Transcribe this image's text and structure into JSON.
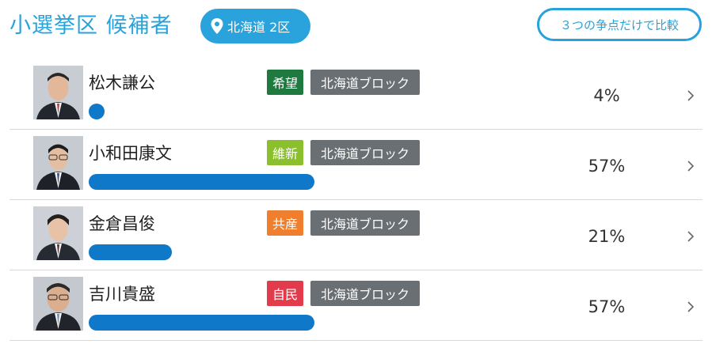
{
  "header": {
    "title": "小選挙区 候補者",
    "district": "北海道 2区",
    "compare_label": "３つの争点だけで比較"
  },
  "colors": {
    "accent": "#27a2dc",
    "bar": "#0f78c8",
    "block": "#6a6f73"
  },
  "candidates": [
    {
      "name": "松木謙公",
      "party": "希望",
      "party_color": "#1f7a3f",
      "block": "北海道ブロック",
      "percent_label": "4%",
      "percent": 4
    },
    {
      "name": "小和田康文",
      "party": "維新",
      "party_color": "#8bbf2e",
      "block": "北海道ブロック",
      "percent_label": "57%",
      "percent": 57
    },
    {
      "name": "金倉昌俊",
      "party": "共産",
      "party_color": "#ef7f2e",
      "block": "北海道ブロック",
      "percent_label": "21%",
      "percent": 21
    },
    {
      "name": "吉川貴盛",
      "party": "自民",
      "party_color": "#e23b4c",
      "block": "北海道ブロック",
      "percent_label": "57%",
      "percent": 57
    }
  ]
}
